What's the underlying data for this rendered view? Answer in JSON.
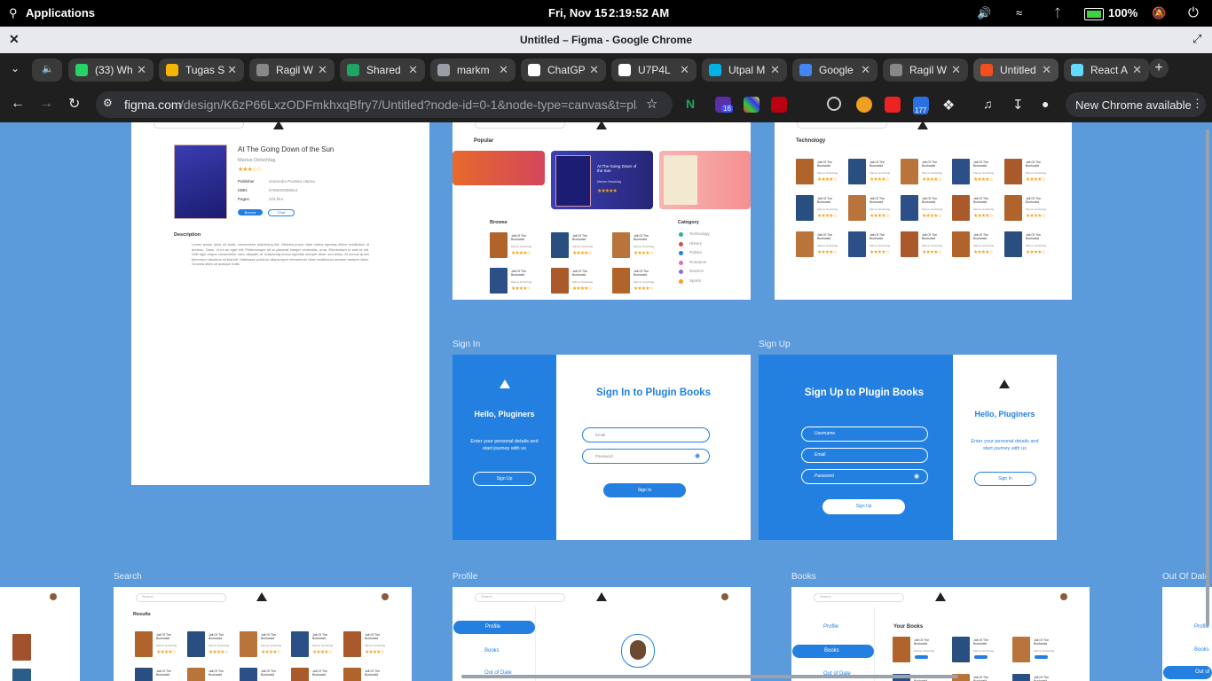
{
  "os": {
    "apps_label": "Applications",
    "date": "Fri, Nov 15",
    "time": "2:19:52 AM",
    "battery": "100%"
  },
  "window": {
    "title": "Untitled – Figma - Google Chrome"
  },
  "tabs": [
    {
      "label": "(33) Wh",
      "color": "#25d366",
      "badge": "33"
    },
    {
      "label": "Tugas S",
      "color": "#f5b400"
    },
    {
      "label": "Ragil W",
      "color": "#888888"
    },
    {
      "label": "Shared",
      "color": "#1fa463"
    },
    {
      "label": "markm",
      "color": "#9aa0a6"
    },
    {
      "label": "ChatGP",
      "color": "#ffffff"
    },
    {
      "label": "U7P4L",
      "color": "#ffffff"
    },
    {
      "label": "Utpal M",
      "color": "#00b4e6"
    },
    {
      "label": "Google",
      "color": "#4285f4"
    },
    {
      "label": "Ragil W",
      "color": "#888888"
    },
    {
      "label": "Untitled",
      "color": "#f24e1e",
      "active": true
    },
    {
      "label": "React A",
      "color": "#61dafb"
    }
  ],
  "address": {
    "host": "figma.com",
    "path": "/design/K6zP66LxzODFmkhxqBfry7/Untitled?node-id=0-1&node-type=canvas&t=plJ0...",
    "new_chrome": "New Chrome available",
    "ext_badge_1": "16",
    "ext_badge_2": "177"
  },
  "detail": {
    "title": "At The Going Down of the Sun",
    "author": "Marius Oelschlag",
    "publisher_label": "Publisher",
    "publisher": "Gramedia Pustaka Utama",
    "isbn_label": "ISBN",
    "isbn": "9786020385914",
    "pages_label": "Pages",
    "pages": "376 hlm",
    "borrow": "Borrow",
    "chat": "Chat",
    "desc_heading": "Description",
    "desc": "Lorem ipsum dolor sit amet, consectetur adipiscing elit. Ultricies purus vitae metus egestas etiam vestibulum id doneon. Diam, in mi ac eget elit. Pellentesque sit at placerat integer venenatis, urna. Elementum in erat et elit. Velit eget neque consectetur nunc aliquam at. Adipiscing lectus egestas semper vitae, sed tellus. At cursus quam bibendum faucibus sit blandit. Habitasse pulvinar ullamcorper elementum vitae vestibulum aenean semper diam. Gravida diam sit quisque nulla."
  },
  "home": {
    "popular_heading": "Popular",
    "popular_title": "At The Going Down of the Sun",
    "popular_author": "Marius Oelschlag",
    "browse_heading": "Browse",
    "category_heading": "Category",
    "categories": [
      "Technology",
      "History",
      "Politics",
      "Romance",
      "Science",
      "Sports"
    ],
    "book_title": "Jalt Of The Bushwald",
    "book_author": "Marius Oelschlag"
  },
  "technology": {
    "heading": "Technology"
  },
  "signin": {
    "frame_label": "Sign In",
    "hello": "Hello, Pluginers",
    "intro": "Enter your personal details and start journey with us",
    "side_button": "Sign Up",
    "title": "Sign In to Plugin Books",
    "email": "Email",
    "password": "Password",
    "submit": "Sign In"
  },
  "signup": {
    "frame_label": "Sign Up",
    "title": "Sign Up to Plugin Books",
    "username": "Username",
    "email": "Email",
    "password": "Password",
    "submit": "Sign Up",
    "hello": "Hello, Pluginers",
    "intro": "Enter your personal details and start journey with us",
    "side_button": "Sign In"
  },
  "bottom_frames": {
    "search_label": "Search",
    "profile_label": "Profile",
    "books_label": "Books",
    "outofdate_label": "Out Of Date",
    "results_heading": "Results",
    "search_placeholder": "Search",
    "nav_profile": "Profile",
    "nav_books": "Books",
    "nav_outofdate": "Out of Date",
    "your_books": "Your Books"
  },
  "colors": {
    "accent": "#2480e0",
    "canvas": "#5b9bdb",
    "star": "#f5a623"
  }
}
